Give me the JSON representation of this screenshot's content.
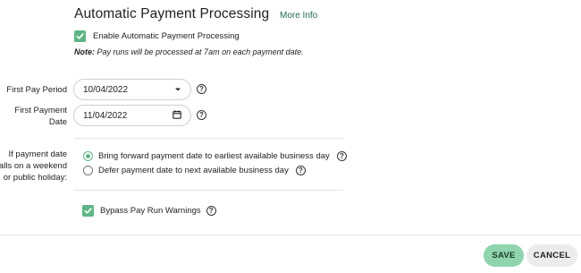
{
  "header": {
    "title": "Automatic Payment Processing",
    "more_info": "More Info"
  },
  "enable_auto": {
    "label": "Enable Automatic Payment Processing",
    "checked": true
  },
  "note": {
    "prefix": "Note:",
    "text": " Pay runs will be processed at 7am on each payment date."
  },
  "first_pay_period": {
    "label": "First Pay Period",
    "value": "10/04/2022",
    "icon": "chevron-down-icon"
  },
  "first_payment_date": {
    "label_line1": "First Payment",
    "label_line2": "Date",
    "value": "11/04/2022",
    "icon": "calendar-icon"
  },
  "weekend_rule": {
    "label_line1": "If payment date",
    "label_line2": "falls on a weekend",
    "label_line3": "or public holiday:",
    "options": [
      {
        "label": "Bring forward payment date to earliest available business day",
        "selected": true
      },
      {
        "label": "Defer payment date to next available business day",
        "selected": false
      }
    ]
  },
  "bypass": {
    "label": "Bypass Pay Run Warnings",
    "checked": true
  },
  "help_glyph": "?",
  "colors": {
    "accent": "#5fb587",
    "save_bg": "#8fd4ac",
    "cancel_bg": "#ececec",
    "link": "#1f6b4a"
  },
  "actions": {
    "save": "SAVE",
    "cancel": "CANCEL"
  }
}
